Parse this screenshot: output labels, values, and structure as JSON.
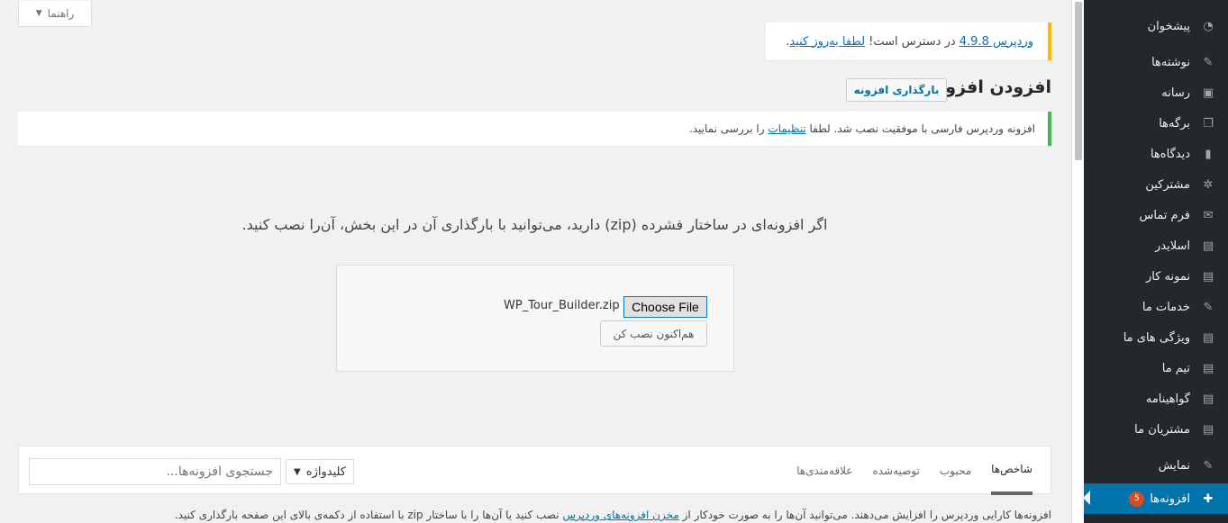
{
  "help_tab": {
    "label": "راهنما"
  },
  "update_notice": {
    "link_version": "وردپرس 4.9.8",
    "middle": " در دسترس است! ",
    "link_update": "لطفا به‌روز کنید",
    "end": "."
  },
  "page_title": "افزودن افزونه",
  "upload_button": "بارگذاری افزونه",
  "success_notice": {
    "before": "افزونه وردپرس فارسی با موفقیت نصب شد. لطفا ",
    "link": "تنظیمات",
    "after": " را بررسی نمایید."
  },
  "upload": {
    "instructions": "اگر افزونه‌ای در ساختار فشرده (zip) دارید، می‌توانید با بارگذاری آن در این بخش، آن‌را نصب کنید.",
    "choose_file_label": "Choose File",
    "filename": "WP_Tour_Builder.zip",
    "install_now": "هم‌اکنون نصب کن"
  },
  "filter": {
    "tabs": [
      {
        "label": "شاخص‌ها",
        "current": true
      },
      {
        "label": "محبوب"
      },
      {
        "label": "توصیه‌شده"
      },
      {
        "label": "علاقه‌مندی‌ها"
      }
    ],
    "search_type": "کلیدواژه",
    "search_placeholder": "جستجوی افزونه‌ها..."
  },
  "footer": {
    "before": "افزونه‌ها کارایی وردپرس را افزایش می‌دهند. می‌توانید آن‌ها را به صورت خودکار از ",
    "link": "مخزن افزونه‌های وردپرس",
    "after": " نصب کنید یا آن‌ها را با ساختار zip با استفاده از دکمه‌ی بالای این صفحه بارگذاری کنید."
  },
  "sidebar": {
    "items": [
      {
        "label": "پیشخوان",
        "icon": "dashboard-icon",
        "glyph": "◔"
      },
      {
        "label": "نوشته‌ها",
        "icon": "pin-icon",
        "glyph": "✎",
        "gap": true
      },
      {
        "label": "رسانه",
        "icon": "media-icon",
        "glyph": "▣"
      },
      {
        "label": "برگه‌ها",
        "icon": "pages-icon",
        "glyph": "❐"
      },
      {
        "label": "دیدگاه‌ها",
        "icon": "comments-icon",
        "glyph": "▮"
      },
      {
        "label": "مشترکین",
        "icon": "users-icon",
        "glyph": "✲"
      },
      {
        "label": "فرم تماس",
        "icon": "mail-icon",
        "glyph": "✉"
      },
      {
        "label": "اسلایدر",
        "icon": "table-icon",
        "glyph": "▤"
      },
      {
        "label": "نمونه کار",
        "icon": "table-icon",
        "glyph": "▤"
      },
      {
        "label": "خدمات ما",
        "icon": "pin-icon",
        "glyph": "✎"
      },
      {
        "label": "ویژگی های ما",
        "icon": "table-icon",
        "glyph": "▤"
      },
      {
        "label": "تیم ما",
        "icon": "table-icon",
        "glyph": "▤"
      },
      {
        "label": "گواهینامه",
        "icon": "table-icon",
        "glyph": "▤"
      },
      {
        "label": "مشتریان ما",
        "icon": "table-icon",
        "glyph": "▤"
      },
      {
        "label": "نمایش",
        "icon": "appearance-icon",
        "glyph": "✎",
        "gap": true
      },
      {
        "label": "افزونه‌ها",
        "icon": "plugins-icon",
        "glyph": "✚",
        "active": true,
        "badge": "5"
      }
    ]
  },
  "colors": {
    "accent": "#0073aa",
    "sidebar": "#23282d",
    "success": "#46b450",
    "warning": "#ffb900"
  }
}
